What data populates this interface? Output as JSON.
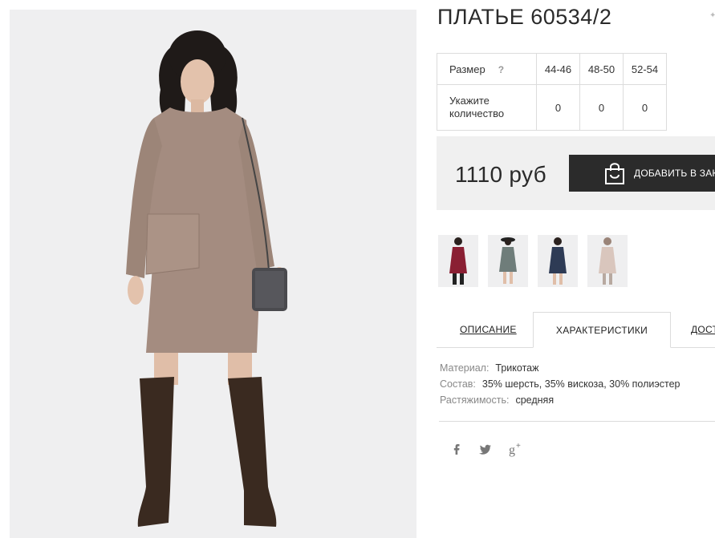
{
  "product": {
    "title": "ПЛАТЬЕ 60534/2",
    "price": "1110 руб",
    "add_to_cart_label": "ДОБАВИТЬ В ЗАКАЗ"
  },
  "size_table": {
    "size_label": "Размер",
    "help": "?",
    "sizes": [
      "44-46",
      "48-50",
      "52-54"
    ],
    "quantity_label": "Укажите количество",
    "quantities": [
      "0",
      "0",
      "0"
    ]
  },
  "color_thumbnails": [
    {
      "icon": "dress-thumbnail",
      "color": "#8a1f33"
    },
    {
      "icon": "dress-thumbnail",
      "color": "#6f7d7a"
    },
    {
      "icon": "dress-thumbnail",
      "color": "#2e3b55"
    },
    {
      "icon": "dress-thumbnail",
      "color": "#d9c6bd"
    }
  ],
  "tabs": [
    {
      "label": "ОПИСАНИЕ",
      "active": false
    },
    {
      "label": "ХАРАКТЕРИСТИКИ",
      "active": true
    },
    {
      "label": "ДОСТАВКА",
      "active": false
    }
  ],
  "specs": [
    {
      "key": "Материал:",
      "value": "Трикотаж"
    },
    {
      "key": "Состав:",
      "value": "35% шерсть, 35% вискоза, 30% полиэстер"
    },
    {
      "key": "Растяжимость:",
      "value": "средняя"
    }
  ],
  "social": [
    {
      "icon": "facebook-icon",
      "glyph": "f"
    },
    {
      "icon": "twitter-icon",
      "glyph": "t"
    },
    {
      "icon": "google-plus-icon",
      "glyph": "g+"
    }
  ],
  "colors": {
    "button_bg": "#2b2b2b",
    "price_box_bg": "#f0f0f0",
    "dress_main": "#a48c80",
    "boots": "#3a2a20"
  }
}
